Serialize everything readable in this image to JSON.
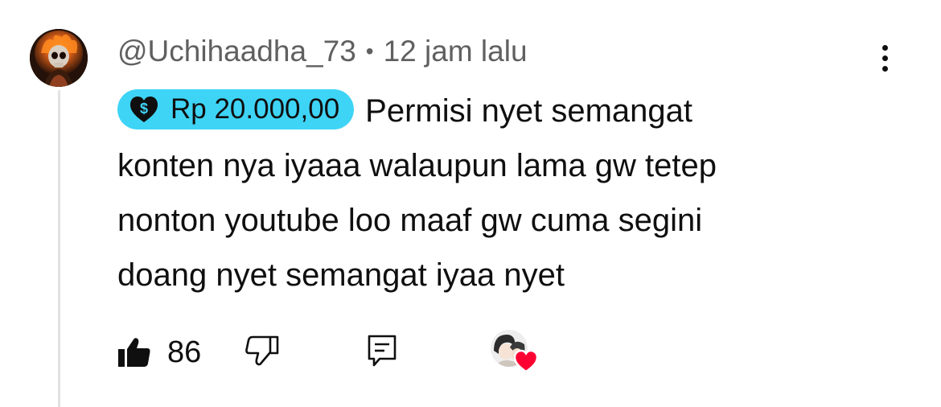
{
  "comment": {
    "author": "@Uchihaadha_73",
    "separator": "•",
    "timestamp": "12 jam lalu",
    "super_thanks": {
      "amount": "Rp 20.000,00",
      "chip_color": "#3ed4f6",
      "icon": "dollar-heart-icon"
    },
    "text_lines": [
      "Permisi nyet semangat",
      "konten nya iyaaa walaupun lama gw tetep",
      "nonton youtube loo maaf gw cuma segini",
      "doang nyet semangat iyaa nyet"
    ]
  },
  "actions": {
    "like_count": "86",
    "like_icon": "thumbs-up-filled-icon",
    "dislike_icon": "thumbs-down-icon",
    "reply_icon": "reply-comment-icon",
    "creator_heart_icon": "creator-heart-icon",
    "heart_color": "#ff0033"
  },
  "menu": {
    "icon": "more-vertical-icon"
  }
}
